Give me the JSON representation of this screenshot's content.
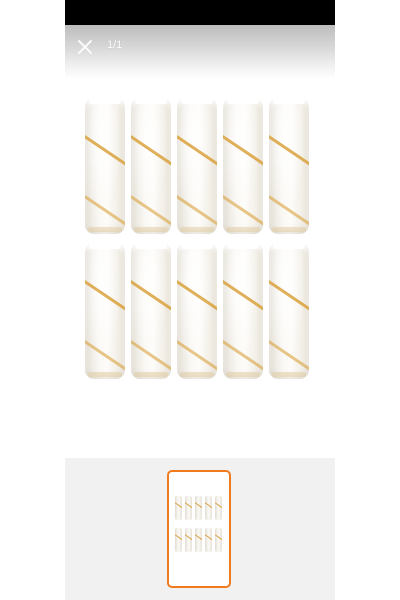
{
  "viewer": {
    "page_counter": "1/1",
    "close_icon": "close-icon",
    "accent_color": "#ef7b1e"
  },
  "image": {
    "subject": "paint-roller-covers",
    "item_count": 10,
    "rows": 2,
    "columns": 5
  },
  "thumbnails": [
    {
      "selected": true
    }
  ]
}
